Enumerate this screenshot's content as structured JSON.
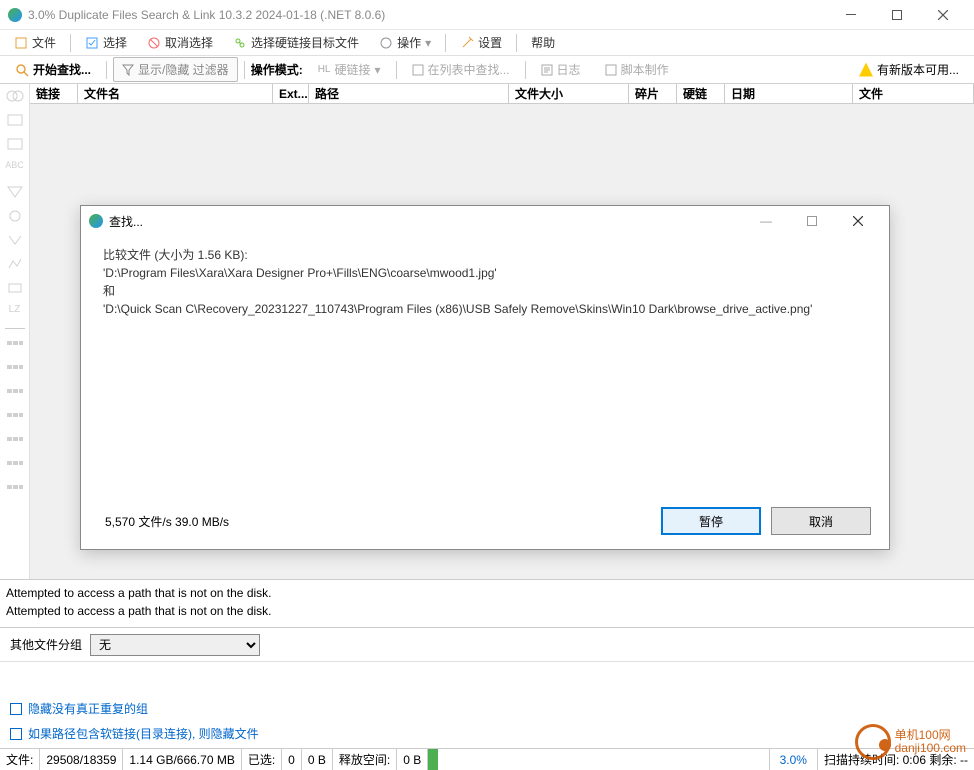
{
  "title": "3.0% Duplicate Files Search & Link 10.3.2 2024-01-18 (.NET 8.0.6)",
  "menu": {
    "file": "文件",
    "select": "选择",
    "deselect": "取消选择",
    "hardlink_target": "选择硬链接目标文件",
    "operate": "操作",
    "settings": "设置",
    "help": "帮助"
  },
  "tb": {
    "start_search": "开始查找...",
    "show_hide_filter": "显示/隐藏 过滤器",
    "op_mode": "操作模式:",
    "hardlink": "硬链接",
    "search_in_list": "在列表中查找...",
    "log": "日志",
    "script": "脚本制作",
    "new_version": "有新版本可用..."
  },
  "cols": {
    "link": "链接",
    "filename": "文件名",
    "ext": "Ext...",
    "path": "路径",
    "filesize": "文件大小",
    "frag": "碎片",
    "hardlink": "硬链",
    "date": "日期",
    "file": "文件"
  },
  "dialog": {
    "title": "查找...",
    "line1": "比较文件 (大小为 1.56 KB):",
    "line2": "'D:\\Program Files\\Xara\\Xara Designer Pro+\\Fills\\ENG\\coarse\\mwood1.jpg'",
    "line3": "和",
    "line4": "'D:\\Quick Scan C\\Recovery_20231227_110743\\Program Files (x86)\\USB Safely Remove\\Skins\\Win10 Dark\\browse_drive_active.png'",
    "stats": "5,570 文件/s    39.0 MB/s",
    "pause": "暂停",
    "cancel": "取消"
  },
  "logs": {
    "l1": "Attempted to access a path that is not on the disk.",
    "l2": "Attempted to access a path that is not on the disk."
  },
  "group": {
    "label": "其他文件分组",
    "value": "无"
  },
  "chk": {
    "c1": "隐藏没有真正重复的组",
    "c2": "如果路径包含软链接(目录连接), 则隐藏文件"
  },
  "status": {
    "file_lbl": "文件:",
    "file_val": "29508/18359",
    "size": "1.14 GB/666.70 MB",
    "sel_lbl": "已选:",
    "sel_val": "0",
    "zero": "0 B",
    "free_lbl": "释放空间:",
    "free_val": "0 B",
    "pct": "3.0%",
    "scan": "扫描持续时间:   0:06  剩余:   --"
  },
  "wm": {
    "t1": "单机100网",
    "t2": "danji100.com"
  }
}
